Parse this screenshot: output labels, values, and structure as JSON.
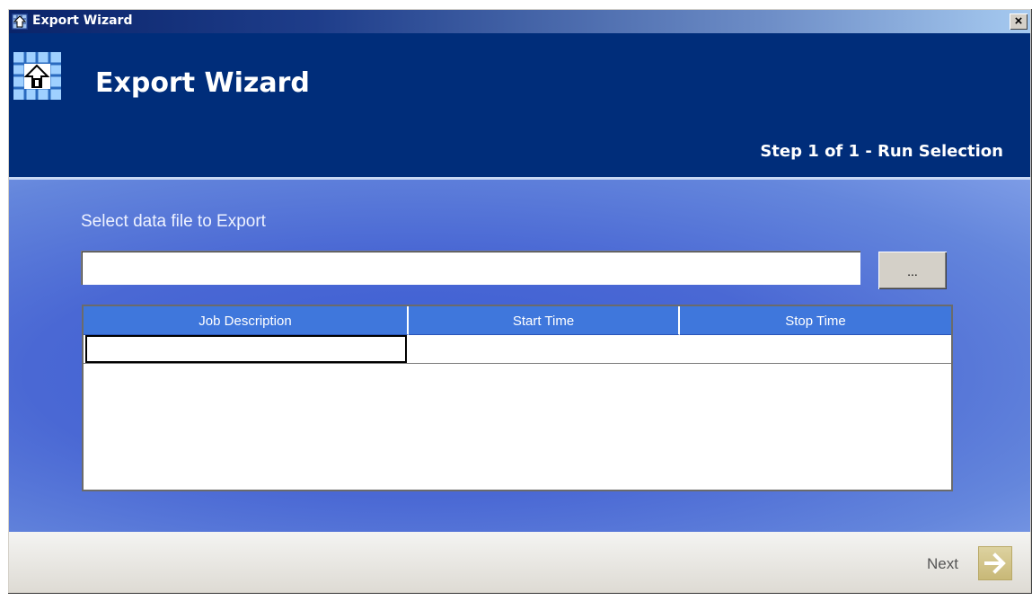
{
  "window": {
    "title": "Export Wizard",
    "close_label": "×"
  },
  "header": {
    "title": "Export Wizard",
    "step_text": "Step 1 of 1 - Run Selection"
  },
  "main": {
    "select_label": "Select data file to Export",
    "file_input_value": "",
    "browse_label": "...",
    "table": {
      "columns": [
        "Job Description",
        "Start Time",
        "Stop Time"
      ],
      "rows": [
        [
          "",
          "",
          ""
        ]
      ]
    }
  },
  "footer": {
    "next_label": "Next"
  },
  "colors": {
    "header_bg": "#002d7a",
    "content_bg": "#4a68d4",
    "table_header_bg": "#3f77dc"
  },
  "icons": {
    "title_icon": "export-house-icon",
    "next_icon": "arrow-right-icon"
  }
}
